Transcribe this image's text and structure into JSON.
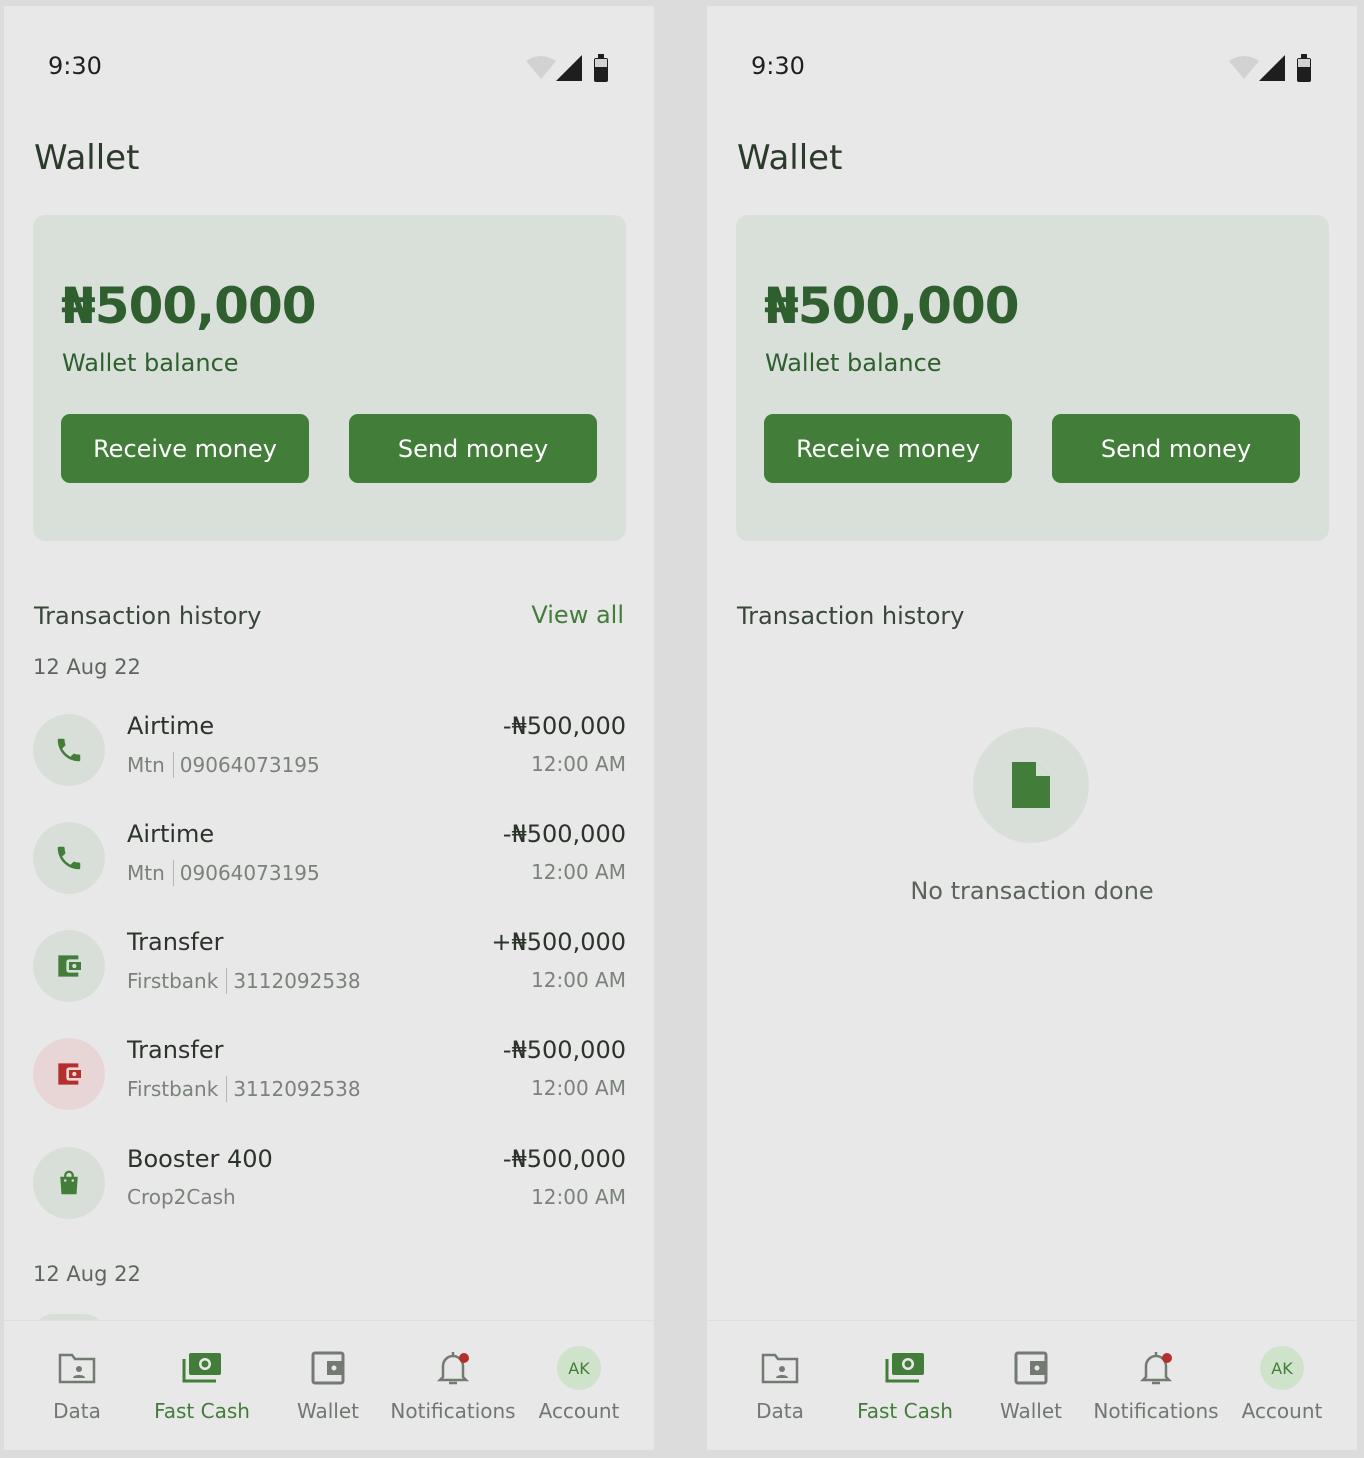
{
  "screens": [
    {
      "status_time": "9:30",
      "title": "Wallet",
      "balance": {
        "amount": "₦500,000",
        "label": "Wallet balance"
      },
      "receive_label": "Receive money",
      "send_label": "Send money",
      "history_title": "Transaction history",
      "view_all": "View all",
      "date1": "12 Aug 22",
      "date2": "12 Aug 22",
      "transactions": [
        {
          "icon": "phone-icon",
          "title": "Airtime",
          "provider": "Mtn",
          "ref": "09064073195",
          "amount": "-₦500,000",
          "time": "12:00 AM"
        },
        {
          "icon": "phone-icon",
          "title": "Airtime",
          "provider": "Mtn",
          "ref": "09064073195",
          "amount": "-₦500,000",
          "time": "12:00 AM"
        },
        {
          "icon": "wallet-icon",
          "title": "Transfer",
          "provider": "Firstbank",
          "ref": "3112092538",
          "amount": "+₦500,000",
          "time": "12:00 AM"
        },
        {
          "icon": "wallet-icon",
          "title": "Transfer",
          "provider": "Firstbank",
          "ref": "3112092538",
          "amount": "-₦500,000",
          "time": "12:00 AM"
        },
        {
          "icon": "shopping-bag-icon",
          "title": "Booster 400",
          "provider": "Crop2Cash",
          "ref": "",
          "amount": "-₦500,000",
          "time": "12:00 AM"
        }
      ]
    },
    {
      "status_time": "9:30",
      "title": "Wallet",
      "balance": {
        "amount": "₦500,000",
        "label": "Wallet balance"
      },
      "receive_label": "Receive money",
      "send_label": "Send money",
      "history_title": "Transaction history",
      "empty_text": "No transaction done"
    }
  ],
  "nav": [
    {
      "label": "Data",
      "icon": "folder-icon"
    },
    {
      "label": "Fast Cash",
      "icon": "cash-icon",
      "active": true
    },
    {
      "label": "Wallet",
      "icon": "wallet-icon"
    },
    {
      "label": "Notifications",
      "icon": "bell-icon"
    },
    {
      "label": "Account",
      "icon": "avatar",
      "initials": "AK"
    }
  ],
  "colors": {
    "primary": "#437d3a",
    "balance_text": "#2f5f2e",
    "card_bg": "#d9e0d9",
    "screen_bg": "#e8e8e8",
    "negative_accent": "#b3302c"
  }
}
